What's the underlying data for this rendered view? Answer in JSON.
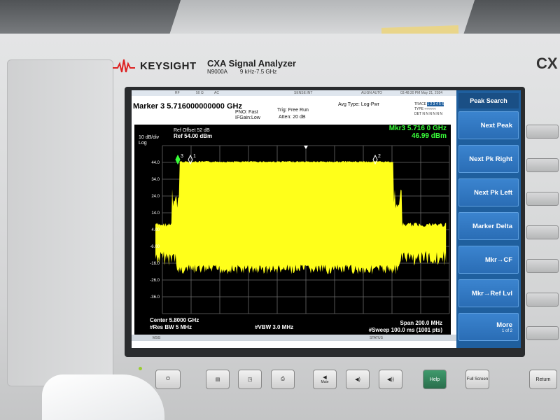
{
  "device": {
    "brand": "KEYSIGHT",
    "model_title": "CXA Signal Analyzer",
    "model_number": "N9000A",
    "freq_range": "9 kHz-7.5 GHz",
    "series_label": "CX"
  },
  "topbar": {
    "rf": "RF",
    "ohm": "50 Ω",
    "ac": "AC",
    "sense": "SENSE:INT",
    "align": "ALIGN AUTO",
    "datetime": "03:48:30 PM May 21, 2024"
  },
  "marker": {
    "readout": "Marker 3 5.716000000000 GHz",
    "pno": "PNO: Fast",
    "ifgain": "IFGain:Low",
    "trig": "Trig: Free Run",
    "atten": "Atten: 20 dB",
    "avg_type": "Avg Type: Log-Pwr"
  },
  "trace_info": {
    "trace_label": "TRACE",
    "trace_nums": "1 2 3 4 5 6",
    "type_label": "TYPE",
    "det_label": "DET",
    "det_values": "N N N N N N"
  },
  "plot": {
    "scale": "10 dB/div",
    "log": "Log",
    "ref_offset": "Ref Offset 52 dB",
    "ref_level": "Ref 54.00 dBm",
    "mkr_freq": "Mkr3 5.716 0 GHz",
    "mkr_amp": "46.99 dBm",
    "y_ticks": [
      "44.0",
      "34.0",
      "24.0",
      "14.0",
      "4.00",
      "-6.00",
      "-16.0",
      "-26.0",
      "-36.0"
    ],
    "center": "Center 5.8000 GHz",
    "res_bw": "#Res BW 5 MHz",
    "vbw": "#VBW 3.0 MHz",
    "span": "Span 200.0 MHz",
    "sweep": "#Sweep 100.0 ms (1001 pts)",
    "markers": [
      "3",
      "1",
      "2"
    ],
    "trace_color": "#ffff1a"
  },
  "status": {
    "msg": "MSG",
    "status": "STATUS"
  },
  "softkeys": {
    "title": "Peak Search",
    "items": [
      "Next Peak",
      "Next Pk Right",
      "Next Pk Left",
      "Marker Delta",
      "Mkr→CF",
      "Mkr→Ref Lvl",
      "More"
    ],
    "more_page": "1 of 2"
  },
  "front_panel": {
    "mute": "Mute",
    "help": "Help",
    "full_screen": "Full Screen",
    "return": "Return"
  }
}
